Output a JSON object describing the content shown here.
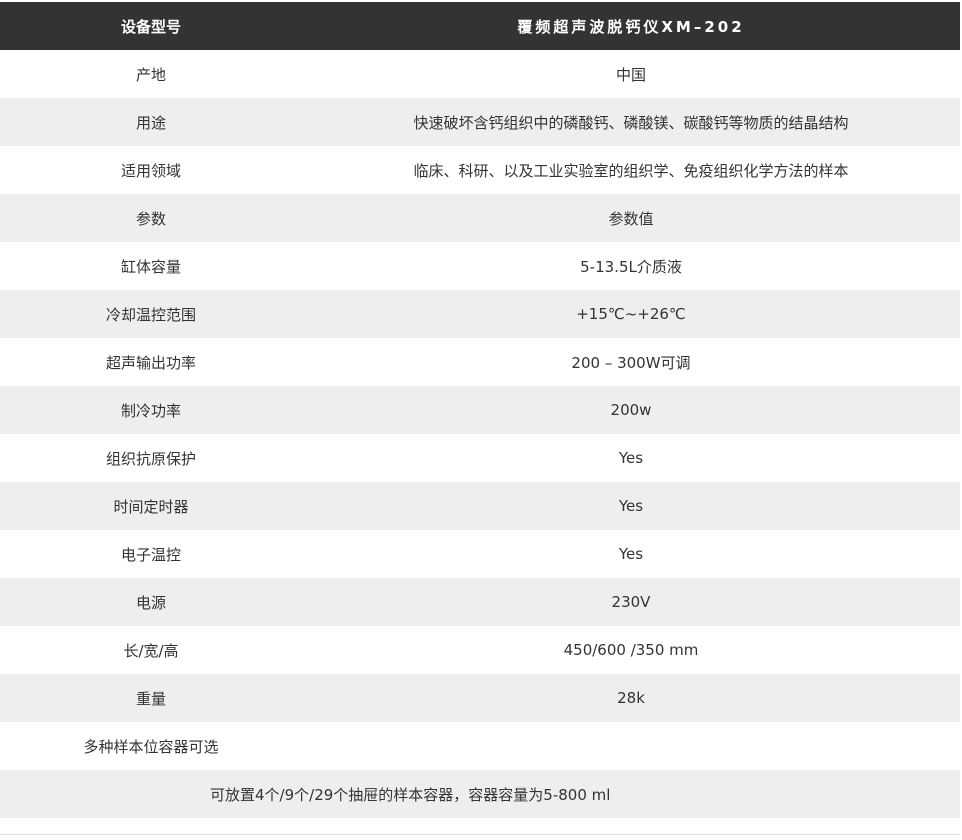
{
  "table": {
    "header": {
      "key": "设备型号",
      "value": "覆频超声波脱钙仪XM–202"
    },
    "rows": [
      {
        "key": "产地",
        "value": "中国"
      },
      {
        "key": "用途",
        "value": "快速破坏含钙组织中的磷酸钙、磷酸镁、碳酸钙等物质的结晶结构"
      },
      {
        "key": "适用领域",
        "value": "临床、科研、以及工业实验室的组织学、免疫组织化学方法的样本"
      },
      {
        "key": "参数",
        "value": "参数值"
      },
      {
        "key": "缸体容量",
        "value": "5-13.5L介质液"
      },
      {
        "key": "冷却温控范围",
        "value": "+15℃~+26℃"
      },
      {
        "key": "超声输出功率",
        "value": "200 – 300W可调"
      },
      {
        "key": "制冷功率",
        "value": "200w"
      },
      {
        "key": "组织抗原保护",
        "value": "Yes"
      },
      {
        "key": "时间定时器",
        "value": "Yes"
      },
      {
        "key": "电子温控",
        "value": "Yes"
      },
      {
        "key": "电源",
        "value": "230V"
      },
      {
        "key": "长/宽/高",
        "value": "450/600  /350  mm"
      },
      {
        "key": "重量",
        "value": "28k"
      },
      {
        "key": "多种样本位容器可选",
        "value": ""
      }
    ],
    "footer_note": "可放置4个/9个/29个抽屉的样本容器，容器容量为5-800 ml"
  },
  "colors": {
    "header_bg": "#333333",
    "header_text": "#ffffff",
    "alt_row_bg": "#eeeeee",
    "text": "#333333"
  }
}
